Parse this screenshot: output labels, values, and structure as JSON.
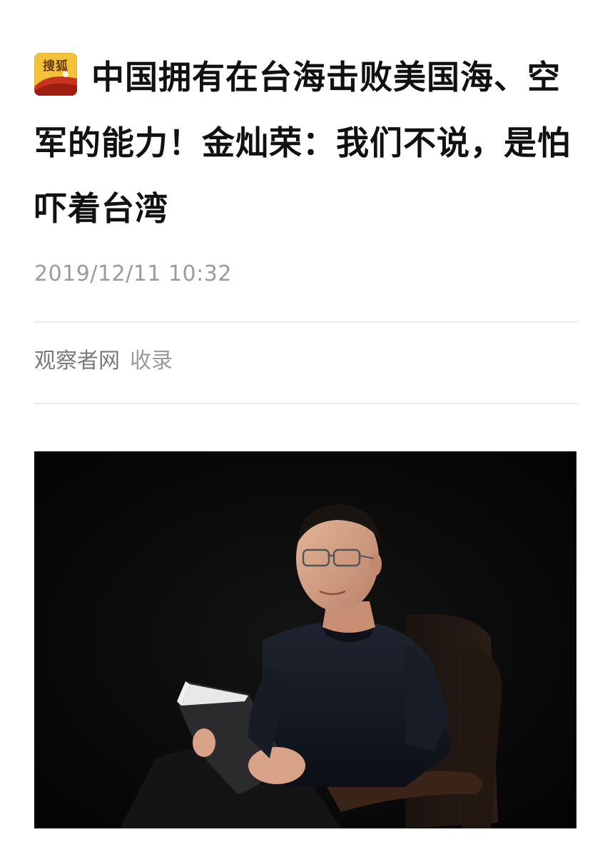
{
  "article": {
    "logo_text": "搜狐",
    "headline": "中国拥有在台海击败美国海、空军的能力！金灿荣：我们不说，是怕吓着台湾",
    "timestamp": "2019/12/11 10:32",
    "source_name": "观察者网",
    "source_action": "收录",
    "photo": {
      "icon": "portrait-photo"
    }
  },
  "colors": {
    "logo_bg": "#f2c23a",
    "logo_accent": "#c8331f",
    "headline": "#111111",
    "meta_text": "#9b9b9b",
    "divider": "#ececec",
    "photo_bg": "#050505"
  }
}
